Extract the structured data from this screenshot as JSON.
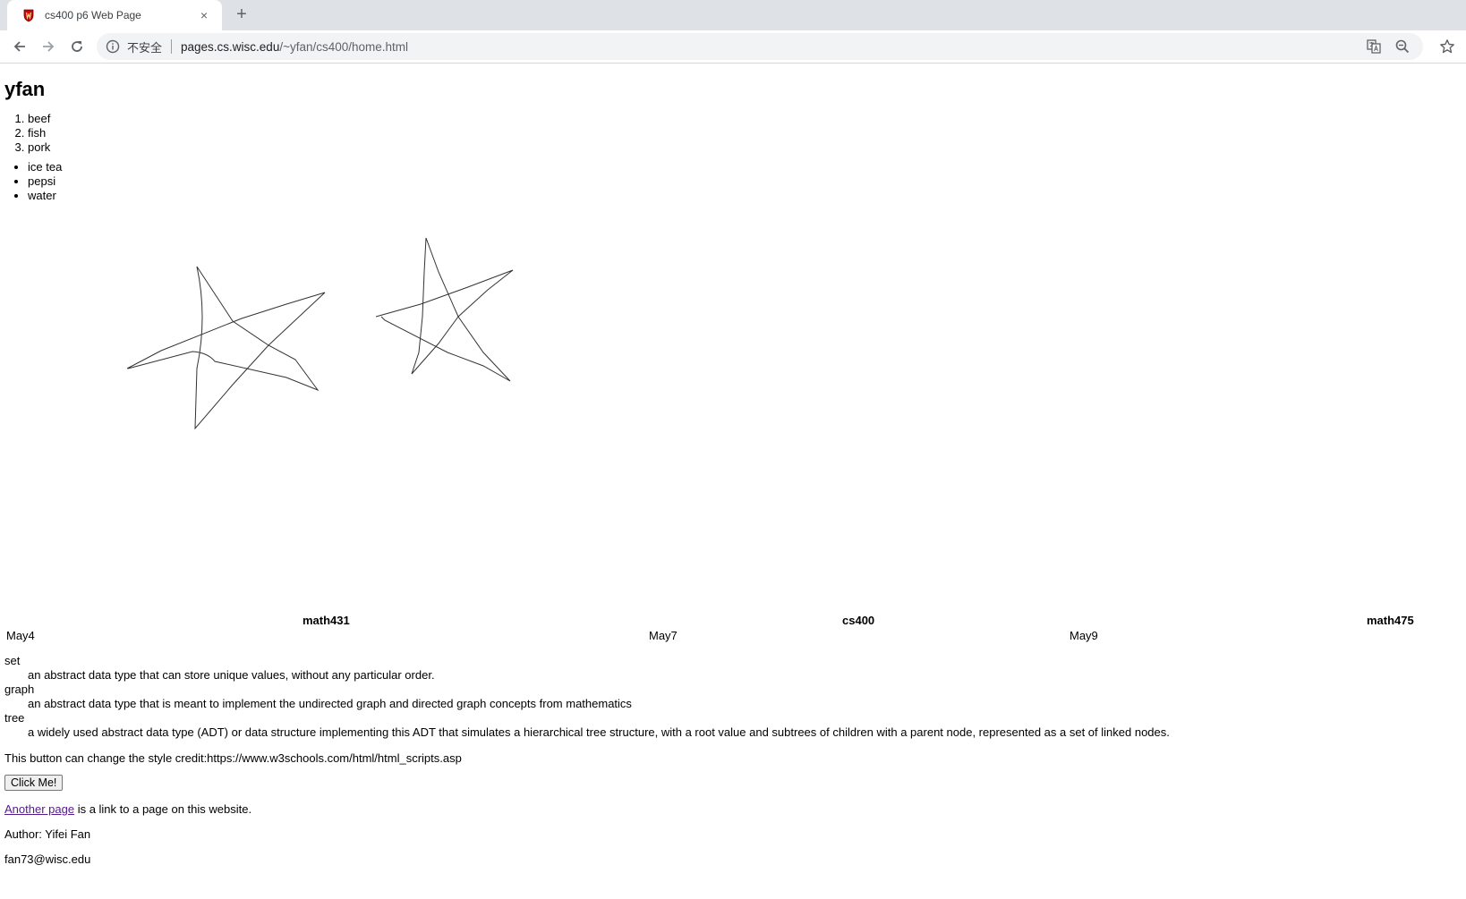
{
  "browser": {
    "tab_title": "cs400 p6 Web Page",
    "tab_close": "×",
    "new_tab": "+",
    "security_label": "不安全",
    "url_host": "pages.cs.wisc.edu",
    "url_path": "/~yfan/cs400/home.html"
  },
  "page": {
    "heading": "yfan",
    "ordered_list": [
      "beef",
      "fish",
      "pork"
    ],
    "unordered_list": [
      "ice tea",
      "pepsi",
      "water"
    ],
    "timeline": {
      "headers": [
        "math431",
        "cs400",
        "math475"
      ],
      "dates": [
        "May4",
        "May7",
        "May9"
      ]
    },
    "definitions": [
      {
        "term": "set",
        "desc": "an abstract data type that can store unique values, without any particular order."
      },
      {
        "term": "graph",
        "desc": "an abstract data type that is meant to implement the undirected graph and directed graph concepts from mathematics"
      },
      {
        "term": "tree",
        "desc": "a widely used abstract data type (ADT) or data structure implementing this ADT that simulates a hierarchical tree structure, with a root value and subtrees of children with a parent node, represented as a set of linked nodes."
      }
    ],
    "button_note": "This button can change the style credit:https://www.w3schools.com/html/html_scripts.asp",
    "button_label": "Click Me!",
    "link_text": "Another page",
    "link_suffix": " is a link to a page on this website.",
    "author": "Author: Yifei Fan",
    "email": "fan73@wisc.edu"
  }
}
